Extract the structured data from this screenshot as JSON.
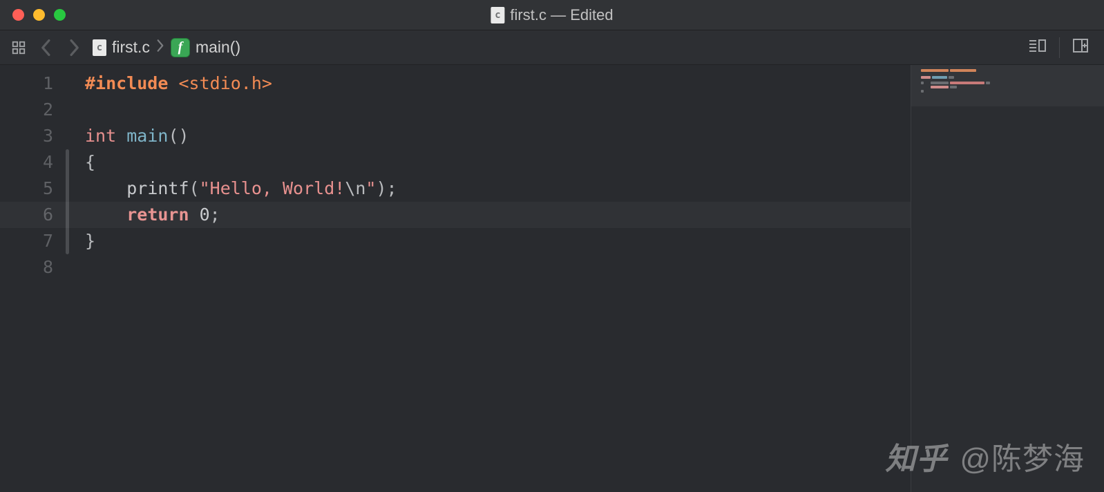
{
  "window": {
    "title": "first.c — Edited",
    "file_icon_letter": "c"
  },
  "breadcrumb": {
    "file_icon_letter": "c",
    "file": "first.c",
    "fn_badge": "f",
    "symbol": "main()"
  },
  "editor": {
    "active_line": 6,
    "line_numbers": [
      "1",
      "2",
      "3",
      "4",
      "5",
      "6",
      "7",
      "8"
    ],
    "lines": [
      {
        "tokens": [
          {
            "t": "#include",
            "c": "tok-pre"
          },
          {
            "t": " ",
            "c": "tok-plain"
          },
          {
            "t": "<stdio.h>",
            "c": "tok-inc"
          }
        ]
      },
      {
        "tokens": []
      },
      {
        "tokens": [
          {
            "t": "int",
            "c": "tok-type"
          },
          {
            "t": " ",
            "c": "tok-plain"
          },
          {
            "t": "main",
            "c": "tok-fn"
          },
          {
            "t": "()",
            "c": "tok-punc"
          }
        ]
      },
      {
        "tokens": [
          {
            "t": "{",
            "c": "tok-punc"
          }
        ]
      },
      {
        "tokens": [
          {
            "t": "    ",
            "c": "tok-plain"
          },
          {
            "t": "printf",
            "c": "tok-call"
          },
          {
            "t": "(",
            "c": "tok-punc"
          },
          {
            "t": "\"Hello, World!",
            "c": "tok-str"
          },
          {
            "t": "\\n",
            "c": "tok-esc"
          },
          {
            "t": "\"",
            "c": "tok-str"
          },
          {
            "t": ");",
            "c": "tok-punc"
          }
        ]
      },
      {
        "tokens": [
          {
            "t": "    ",
            "c": "tok-plain"
          },
          {
            "t": "return",
            "c": "tok-kw"
          },
          {
            "t": " ",
            "c": "tok-plain"
          },
          {
            "t": "0",
            "c": "tok-num"
          },
          {
            "t": ";",
            "c": "tok-punc"
          }
        ]
      },
      {
        "tokens": [
          {
            "t": "}",
            "c": "tok-punc"
          }
        ]
      },
      {
        "tokens": []
      }
    ]
  },
  "watermark": {
    "logo": "知乎",
    "author": "@陈梦海"
  }
}
